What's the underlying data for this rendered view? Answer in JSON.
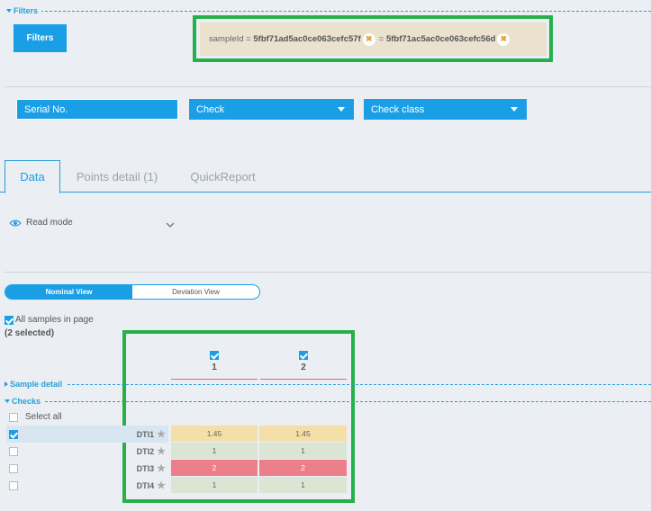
{
  "filters": {
    "section_label": "Filters",
    "button_label": "Filters",
    "chip1_key": "sampleId = ",
    "chip1_value": "5fbf71ad5ac0ce063cefc57f",
    "chip2_key": " = ",
    "chip2_value": "5fbf71ac5ac0ce063cefc56d",
    "chip_remove": "✖"
  },
  "fields": {
    "serial_no": "Serial No.",
    "check": "Check",
    "check_class": "Check class"
  },
  "tabs": [
    {
      "label": "Data"
    },
    {
      "label": "Points detail (1)"
    },
    {
      "label": "QuickReport"
    }
  ],
  "mode": {
    "label": "Read mode"
  },
  "view_toggle": {
    "nominal": "Nominal View",
    "deviation": "Deviation View"
  },
  "samples": {
    "all_label": "All samples in page",
    "selected_count": "(2 selected)",
    "columns": [
      "1",
      "2"
    ]
  },
  "sections": {
    "sample_detail": "Sample detail",
    "checks": "Checks"
  },
  "checks": {
    "select_all": "Select all",
    "rows": [
      {
        "name": "DTI1",
        "values": [
          "1.45",
          "1.45"
        ],
        "checked": true
      },
      {
        "name": "DTI2",
        "values": [
          "1",
          "1"
        ],
        "checked": false
      },
      {
        "name": "DTI3",
        "values": [
          "2",
          "2"
        ],
        "checked": false
      },
      {
        "name": "DTI4",
        "values": [
          "1",
          "1"
        ],
        "checked": false
      }
    ]
  },
  "colors": {
    "accent": "#1a9fe6",
    "highlight_box": "#26b04a",
    "warn": "#f5dfa8",
    "ok": "#dbe5d3",
    "error": "#ec7f8a"
  }
}
